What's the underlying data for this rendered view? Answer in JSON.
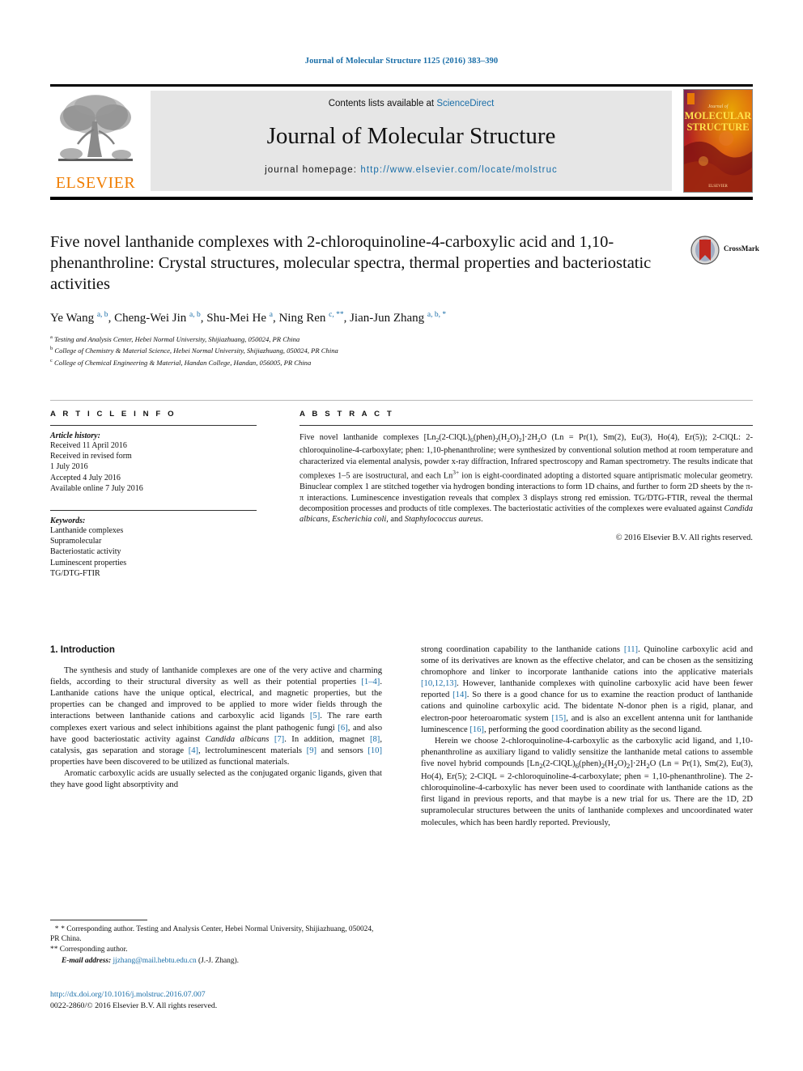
{
  "running_head": "Journal of Molecular Structure 1125 (2016) 383–390",
  "masthead": {
    "contents_prefix": "Contents lists available at ",
    "sciencedirect": "ScienceDirect",
    "journal_title": "Journal of Molecular Structure",
    "homepage_prefix": "journal homepage: ",
    "homepage_url": "http://www.elsevier.com/locate/molstruc",
    "publisher_wordmark": "ELSEVIER",
    "cover_title_line1": "MOLECULAR",
    "cover_title_line2": "STRUCTURE",
    "cover_kicker": "Journal of",
    "accent_color": "#1a6ea8",
    "elsevier_orange": "#F07D00"
  },
  "article": {
    "title": "Five novel lanthanide complexes with 2-chloroquinoline-4-carboxylic acid and 1,10-phenanthroline: Crystal structures, molecular spectra, thermal properties and bacteriostatic activities",
    "authors_html": "Ye Wang <sup>a, b</sup>, Cheng-Wei Jin <sup>a, b</sup>, Shu-Mei He <sup>a</sup>, Ning Ren <sup>c, **</sup>, Jian-Jun Zhang <sup>a, b, *</sup>",
    "affiliations": [
      {
        "mark": "a",
        "text": "Testing and Analysis Center, Hebei Normal University, Shijiazhuang, 050024, PR China"
      },
      {
        "mark": "b",
        "text": "College of Chemistry & Material Science, Hebei Normal University, Shijiazhuang, 050024, PR China"
      },
      {
        "mark": "c",
        "text": "College of Chemical Engineering & Material, Handan College, Handan, 056005, PR China"
      }
    ],
    "crossmark_label": "CrossMark"
  },
  "article_info": {
    "heading": "A R T I C L E  I N F O",
    "history_label": "Article history:",
    "history_lines": [
      "Received 11 April 2016",
      "Received in revised form",
      "1 July 2016",
      "Accepted 4 July 2016",
      "Available online 7 July 2016"
    ],
    "keywords_label": "Keywords:",
    "keywords": [
      "Lanthanide complexes",
      "Supramolecular",
      "Bacteriostatic activity",
      "Luminescent properties",
      "TG/DTG-FTIR"
    ]
  },
  "abstract": {
    "heading": "A B S T R A C T",
    "body_html": "Five novel lanthanide complexes [Ln<sub>2</sub>(2-ClQL)<sub>6</sub>(phen)<sub>2</sub>(H<sub>2</sub>O)<sub>2</sub>]·2H<sub>2</sub>O (Ln = Pr(1), Sm(2), Eu(3), Ho(4), Er(5)); 2-ClQL: 2-chloroquinoline-4-carboxylate; phen: 1,10-phenanthroline; were synthesized by conventional solution method at room temperature and characterized via elemental analysis, powder x-ray diffraction, Infrared spectroscopy and Raman spectrometry. The results indicate that complexes 1–5 are isostructural, and each Ln<sup>3+</sup> ion is eight-coordinated adopting a distorted square antiprismatic molecular geometry. Binuclear complex 1 are stitched together via hydrogen bonding interactions to form 1D chains, and further to form 2D sheets by the π-π interactions. Luminescence investigation reveals that complex 3 displays strong red emission. TG/DTG-FTIR, reveal the thermal decomposition processes and products of title complexes. The bacteriostatic activities of the complexes were evaluated against <i>Candida albicans</i>, <i>Escherichia coli</i>, and <i>Staphylococcus aureus</i>.",
    "copyright": "© 2016 Elsevier B.V. All rights reserved."
  },
  "introduction": {
    "heading": "1.  Introduction",
    "left_paragraphs_html": [
      "The synthesis and study of lanthanide complexes are one of the very active and charming fields, according to their structural diversity as well as their potential properties <span class=\"ref\">[1–4]</span>. Lanthanide cations have the unique optical, electrical, and magnetic properties, but the properties can be changed and improved to be applied to more wider fields through the interactions between lanthanide cations and carboxylic acid ligands <span class=\"ref\">[5]</span>. The rare earth complexes exert various and select inhibitions against the plant pathogenic fungi <span class=\"ref\">[6]</span>, and also have good bacteriostatic activity against <i>Candida albicans</i> <span class=\"ref\">[7]</span>. In addition, magnet <span class=\"ref\">[8]</span>, catalysis, gas separation and storage <span class=\"ref\">[4]</span>, lectroluminescent materials <span class=\"ref\">[9]</span> and sensors <span class=\"ref\">[10]</span> properties have been discovered to be utilized as functional materials.",
      "Aromatic carboxylic acids are usually selected as the conjugated organic ligands, given that they have good light absorptivity and"
    ],
    "right_paragraphs_html": [
      "strong coordination capability to the lanthanide cations <span class=\"ref\">[11]</span>. Quinoline carboxylic acid and some of its derivatives are known as the effective chelator, and can be chosen as the sensitizing chromophore and linker to incorporate lanthanide cations into the applicative materials <span class=\"ref\">[10,12,13]</span>. However, lanthanide complexes with quinoline carboxylic acid have been fewer reported <span class=\"ref\">[14]</span>. So there is a good chance for us to examine the reaction product of lanthanide cations and quinoline carboxylic acid. The bidentate N-donor phen is a rigid, planar, and electron-poor heteroaromatic system <span class=\"ref\">[15]</span>, and is also an excellent antenna unit for lanthanide luminescence <span class=\"ref\">[16]</span>, performing the good coordination ability as the second ligand.",
      "Herein we choose 2-chloroquinoline-4-carboxylic as the carboxylic acid ligand, and 1,10-phenanthroline as auxiliary ligand to validly sensitize the lanthanide metal cations to assemble five novel hybrid compounds [Ln<sub>2</sub>(2-ClQL)<sub>6</sub>(phen)<sub>2</sub>(H<sub>2</sub>O)<sub>2</sub>]·2H<sub>2</sub>O (Ln = Pr(1), Sm(2), Eu(3), Ho(4), Er(5); 2-ClQL = 2-chloroquinoline-4-carboxylate; phen = 1,10-phenanthroline). The 2-chloroquinoline-4-carboxylic has never been used to coordinate with lanthanide cations as the first ligand in previous reports, and that maybe is a new trial for us. There are the 1D, 2D supramolecular structures between the units of lanthanide complexes and uncoordinated water molecules, which has been hardly reported. Previously,"
    ]
  },
  "footnotes": {
    "line1": "* Corresponding author. Testing and Analysis Center, Hebei Normal University, Shijiazhuang, 050024, PR China.",
    "line2": "** Corresponding author.",
    "email_label": "E-mail address:",
    "email": "jjzhang@mail.hebtu.edu.cn",
    "email_suffix": "(J.-J. Zhang)."
  },
  "footer": {
    "doi": "http://dx.doi.org/10.1016/j.molstruc.2016.07.007",
    "issn_line": "0022-2860/© 2016 Elsevier B.V. All rights reserved."
  }
}
